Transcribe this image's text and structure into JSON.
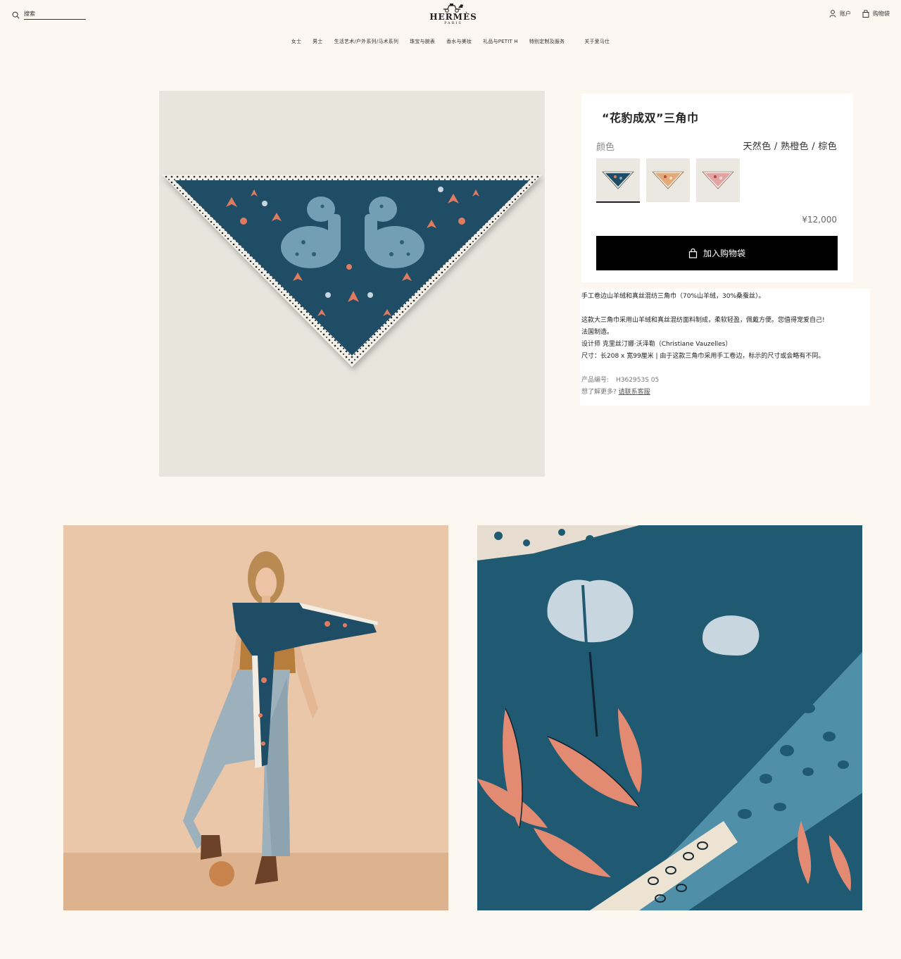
{
  "header": {
    "search_placeholder": "搜索",
    "logo_brand": "HERMÈS",
    "logo_city": "PARIS",
    "account_label": "账户",
    "cart_label": "购物袋"
  },
  "nav": {
    "items": [
      "女士",
      "男士",
      "生活艺术/户外系列/马术系列",
      "珠宝与腕表",
      "香水与美妆",
      "礼品与PETIT H",
      "特别定制及服务",
      "关于爱马仕"
    ]
  },
  "product": {
    "title": "“花豹成双”三角巾",
    "color_label": "颜色",
    "color_value": "天然色 / 熟橙色 / 棕色",
    "swatches": [
      {
        "name": "blue",
        "color": "#1f4d66",
        "selected": true
      },
      {
        "name": "orange",
        "color": "#e3a978",
        "selected": false
      },
      {
        "name": "pink",
        "color": "#e3a3a0",
        "selected": false
      }
    ],
    "price": "¥12,000",
    "add_to_cart_label": "加入购物袋",
    "description": {
      "line1": "手工卷边山羊绒和真丝混纺三角巾（70%山羊绒，30%桑蚕丝）。",
      "line2": "这款大三角巾采用山羊绒和真丝混纺面料制成，柔软轻盈，佩戴方便。您值得宠爱自己!",
      "line3": "法国制造。",
      "line4": "设计师 克里丝汀娜·沃泽勒（Christiane Vauzelles）",
      "line5": "尺寸：长208 x 宽99厘米 | 由于这款三角巾采用手工卷边，标示的尺寸或会略有不同。"
    },
    "code_label": "产品编号:",
    "code_value": "H362953S 05",
    "more_label": "想了解更多?",
    "contact_label": "请联系客服"
  },
  "colors": {
    "background": "#fcf7f1",
    "scarf_blue": "#1f4d66",
    "accent_coral": "#e07b5f",
    "button_black": "#000000"
  }
}
